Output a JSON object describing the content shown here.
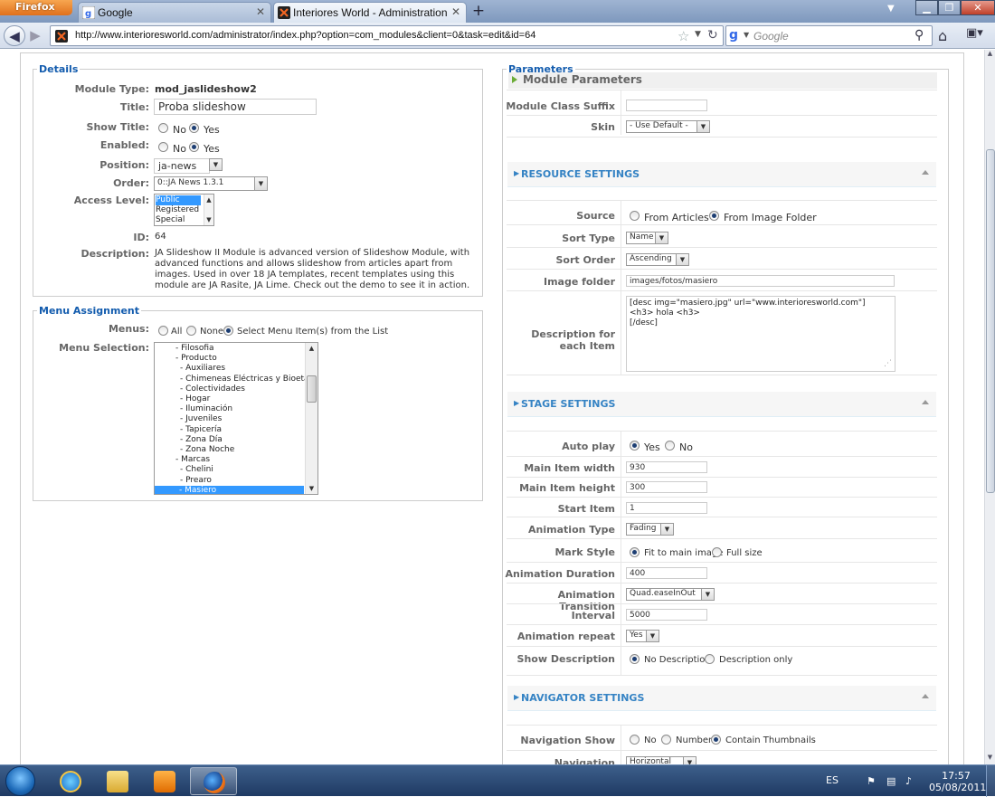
{
  "browser": {
    "app_button": "Firefox",
    "tabs": [
      {
        "label": "Google",
        "active": false
      },
      {
        "label": "Interiores World - Administration",
        "active": true
      }
    ],
    "url": "http://www.interioresworld.com/administrator/index.php?option=com_modules&client=0&task=edit&id=64",
    "search_placeholder": "Google"
  },
  "details": {
    "legend": "Details",
    "module_type_label": "Module Type:",
    "module_type_value": "mod_jaslideshow2",
    "title_label": "Title:",
    "title_value": "Proba slideshow",
    "show_title_label": "Show Title:",
    "enabled_label": "Enabled:",
    "no": "No",
    "yes": "Yes",
    "position_label": "Position:",
    "position_value": "ja-news",
    "order_label": "Order:",
    "order_value": "0::JA News 1.3.1",
    "access_label": "Access Level:",
    "access_options": [
      "Public",
      "Registered",
      "Special"
    ],
    "id_label": "ID:",
    "id_value": "64",
    "description_label": "Description:",
    "description_value": "JA Slideshow II Module is advanced version of Slideshow Module, with advanced functions and allows slideshow from articles apart from images. Used in over 18 JA templates, recent templates using this module are JA Rasite, JA Lime. Check out the demo to see it in action."
  },
  "menu_assignment": {
    "legend": "Menu Assignment",
    "menus_label": "Menus:",
    "menus_options": [
      "All",
      "None",
      "Select Menu Item(s) from the List"
    ],
    "selection_label": "Menu Selection:",
    "items": [
      {
        "text": "- Filosofia",
        "indent": 1
      },
      {
        "text": "- Producto",
        "indent": 1
      },
      {
        "text": "- Auxiliares",
        "indent": 2
      },
      {
        "text": "- Chimeneas Eléctricas y Bioetanol",
        "indent": 2
      },
      {
        "text": "- Colectividades",
        "indent": 2
      },
      {
        "text": "- Hogar",
        "indent": 2
      },
      {
        "text": "- Iluminación",
        "indent": 2
      },
      {
        "text": "- Juveniles",
        "indent": 2
      },
      {
        "text": "- Tapicería",
        "indent": 2
      },
      {
        "text": "- Zona Día",
        "indent": 2
      },
      {
        "text": "- Zona Noche",
        "indent": 2
      },
      {
        "text": "- Marcas",
        "indent": 1
      },
      {
        "text": "- Chelini",
        "indent": 2
      },
      {
        "text": "- Prearo",
        "indent": 2
      },
      {
        "text": "- Masiero",
        "indent": 2
      }
    ]
  },
  "parameters": {
    "legend": "Parameters",
    "module_params_title": "Module Parameters",
    "class_suffix_label": "Module Class Suffix",
    "skin_label": "Skin",
    "skin_value": "- Use Default -",
    "resource_settings": "RESOURCE SETTINGS",
    "source_label": "Source",
    "source_options": [
      "From Articles",
      "From Image Folder"
    ],
    "sort_type_label": "Sort Type",
    "sort_type_value": "Name",
    "sort_order_label": "Sort Order",
    "sort_order_value": "Ascending",
    "image_folder_label": "Image folder",
    "image_folder_value": "images/fotos/masiero",
    "desc_each_label": "Description for each Item",
    "desc_each_value": "[desc img=\"masiero.jpg\" url=\"www.interioresworld.com\"]\n<h3> hola <h3>\n[/desc]",
    "stage_settings": "STAGE SETTINGS",
    "autoplay_label": "Auto play",
    "yes": "Yes",
    "no": "No",
    "main_width_label": "Main Item width",
    "main_width_value": "930",
    "main_height_label": "Main Item height",
    "main_height_value": "300",
    "start_item_label": "Start Item",
    "start_item_value": "1",
    "anim_type_label": "Animation Type",
    "anim_type_value": "Fading",
    "mark_style_label": "Mark Style",
    "mark_style_options": [
      "Fit to main image",
      "Full size"
    ],
    "anim_duration_label": "Animation Duration",
    "anim_duration_value": "400",
    "anim_transition_label": "Animation Transition",
    "anim_transition_value": "Quad.easeInOut",
    "interval_label": "Interval",
    "interval_value": "5000",
    "anim_repeat_label": "Animation repeat",
    "anim_repeat_value": "Yes",
    "show_desc_label": "Show Description",
    "show_desc_options": [
      "No Description",
      "Description only"
    ],
    "navigator_settings": "NAVIGATOR SETTINGS",
    "nav_show_label": "Navigation Show",
    "nav_show_options": [
      "No",
      "Number",
      "Contain Thumbnails"
    ],
    "nav_align_label": "Navigation alignment",
    "nav_align_value": "Horizontal"
  },
  "taskbar": {
    "language": "ES",
    "time": "17:57",
    "date": "05/08/2011"
  }
}
